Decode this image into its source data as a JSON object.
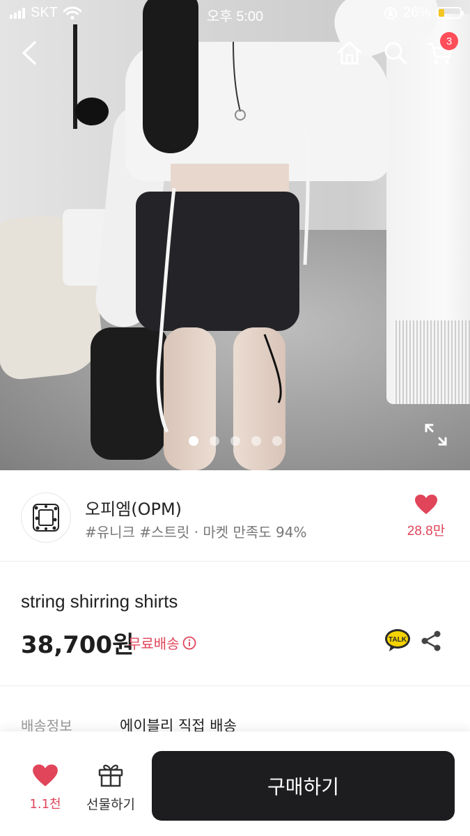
{
  "status_bar": {
    "carrier": "SKT",
    "time": "오후 5:00",
    "battery_percent": "26%",
    "battery_level": 0.26
  },
  "gallery": {
    "image_count": 5,
    "active_index": 0
  },
  "nav": {
    "icons": [
      "back-icon",
      "home-icon",
      "search-icon",
      "cart-icon"
    ],
    "cart_count": "3"
  },
  "shop": {
    "name": "오피엠(OPM)",
    "tags": "#유니크 #스트릿 · 마켓 만족도 94%",
    "like_count": "28.8만"
  },
  "product": {
    "name": "string shirring shirts",
    "price": "38,700원",
    "shipping": "무료배송"
  },
  "delivery": {
    "label": "배송정보",
    "value": "에이블리 직접 배송"
  },
  "bottom_bar": {
    "like_count": "1.1천",
    "gift_label": "선물하기",
    "buy_label": "구매하기"
  },
  "colors": {
    "accent": "#e0455a",
    "badge": "#ff4d5a",
    "buy_button": "#1d1d1f"
  }
}
